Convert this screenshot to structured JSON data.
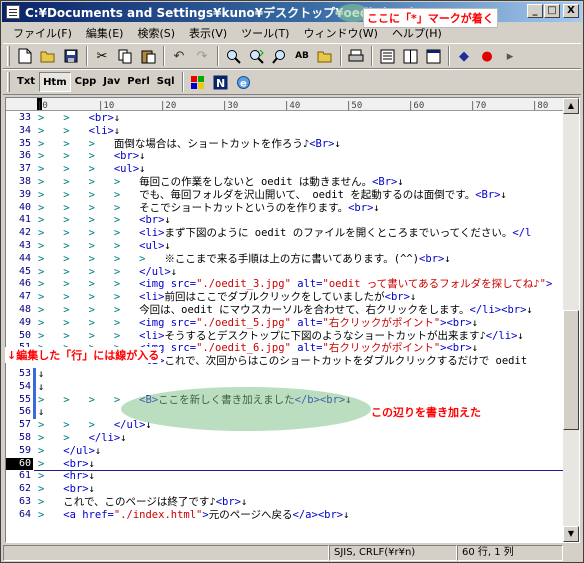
{
  "window": {
    "title": "C:¥Documents and Settings¥kuno¥デスクトップ¥oedit.html",
    "title_mark": " * - ",
    "buttons": [
      "_",
      "□",
      "X"
    ]
  },
  "menu": [
    "ファイル(F)",
    "編集(E)",
    "検索(S)",
    "表示(V)",
    "ツール(T)",
    "ウィンドウ(W)",
    "ヘルプ(H)"
  ],
  "toolbar2": {
    "modes": [
      "Txt",
      "Htm",
      "Cpp",
      "Jav",
      "Perl",
      "Sql"
    ],
    "active_mode": "Htm"
  },
  "ruler": [
    "|0",
    "|10",
    "|20",
    "|30",
    "|40",
    "|50",
    "|60",
    "|70",
    "|80",
    "|90"
  ],
  "lines": [
    {
      "n": "33",
      "ind": ">   >   ",
      "code": "<br>↓"
    },
    {
      "n": "34",
      "ind": ">   >   ",
      "code": "<li>↓"
    },
    {
      "n": "35",
      "ind": ">   >   >   ",
      "code": "面倒な場合は、ショートカットを作ろう♪<Br>↓"
    },
    {
      "n": "36",
      "ind": ">   >   >   ",
      "code": "<br>↓"
    },
    {
      "n": "37",
      "ind": ">   >   >   ",
      "code": "<ul>↓"
    },
    {
      "n": "38",
      "ind": ">   >   >   >   ",
      "code": "毎回この作業をしないと oedit は動きません。<Br>↓"
    },
    {
      "n": "39",
      "ind": ">   >   >   >   ",
      "code": "でも、毎回フォルダを沢山開いて、 oedit を起動するのは面倒です。<Br>↓"
    },
    {
      "n": "40",
      "ind": ">   >   >   >   ",
      "code": "そこでショートカットというのを作ります。<br>↓"
    },
    {
      "n": "41",
      "ind": ">   >   >   >   ",
      "code": "<br>↓"
    },
    {
      "n": "42",
      "ind": ">   >   >   >   ",
      "code": "<li>まず下図のように oedit のファイルを開くところまでいってください。</l"
    },
    {
      "n": "43",
      "ind": ">   >   >   >   ",
      "code": "<ul>↓"
    },
    {
      "n": "44",
      "ind": ">   >   >   >   >   ",
      "code": "※ここまで来る手順は上の方に書いてあります。(^^)<br>↓"
    },
    {
      "n": "45",
      "ind": ">   >   >   >   ",
      "code": "</ul>↓"
    },
    {
      "n": "46",
      "ind": ">   >   >   >   ",
      "code": "<img src=\"./oedit_3.jpg\" alt=\"oedit って書いてあるフォルダを探してね♪\">"
    },
    {
      "n": "47",
      "ind": ">   >   >   >   ",
      "code": "<li>前回はここでダブルクリックをしていましたが<br>↓"
    },
    {
      "n": "48",
      "ind": ">   >   >   >   ",
      "code": "今回は、oedit にマウスカーソルを合わせて、右クリックをします。</li><br>↓"
    },
    {
      "n": "49",
      "ind": ">   >   >   >   ",
      "code": "<img src=\"./oedit_5.jpg\" alt=\"右クリックがポイント\"><br>↓"
    },
    {
      "n": "50",
      "ind": ">   >   >   >   ",
      "code": "<li>そうするとデスクトップに下図のようなショートカットが出来ます♪</li>↓"
    },
    {
      "n": "51",
      "ind": ">   >   >   >   ",
      "code": "<img src=\"./oedit_6.jpg\" alt=\"右クリックがポイント\"><br>↓"
    },
    {
      "n": "52",
      "ind": ">   >   >   >   ",
      "code": "<li>これで、次回からはこのショートカットをダブルクリックするだけで oedit"
    },
    {
      "n": "53",
      "ind": "",
      "code": "↓"
    },
    {
      "n": "54",
      "ind": "",
      "code": "↓"
    },
    {
      "n": "55",
      "ind": ">   >   >   >   ",
      "code": "<B>ここを新しく書き加えました</b><br>↓"
    },
    {
      "n": "56",
      "ind": "",
      "code": "↓"
    },
    {
      "n": "57",
      "ind": ">   >   >   ",
      "code": "</ul>↓"
    },
    {
      "n": "58",
      "ind": ">   >   ",
      "code": "</li>↓"
    },
    {
      "n": "59",
      "ind": ">   ",
      "code": "</ul>↓"
    },
    {
      "n": "60",
      "ind": ">   ",
      "code": "<br>↓"
    },
    {
      "n": "61",
      "ind": ">   ",
      "code": "<hr>↓"
    },
    {
      "n": "62",
      "ind": ">   ",
      "code": "<br>↓"
    },
    {
      "n": "63",
      "ind": ">   ",
      "code": "これで、このページは終了です♪<br>↓"
    },
    {
      "n": "64",
      "ind": ">   ",
      "code": "<a href=\"./index.html\">元のページへ戻る</a><br>↓"
    }
  ],
  "current_line": "60",
  "status": {
    "encoding": "SJIS, CRLF(¥r¥n)",
    "position": "60 行, 1 列"
  },
  "annotations": {
    "top": "ここに「*」マークが着く",
    "left": "↓編集した「行」には線が入る",
    "right": "この辺りを書き加えた"
  }
}
